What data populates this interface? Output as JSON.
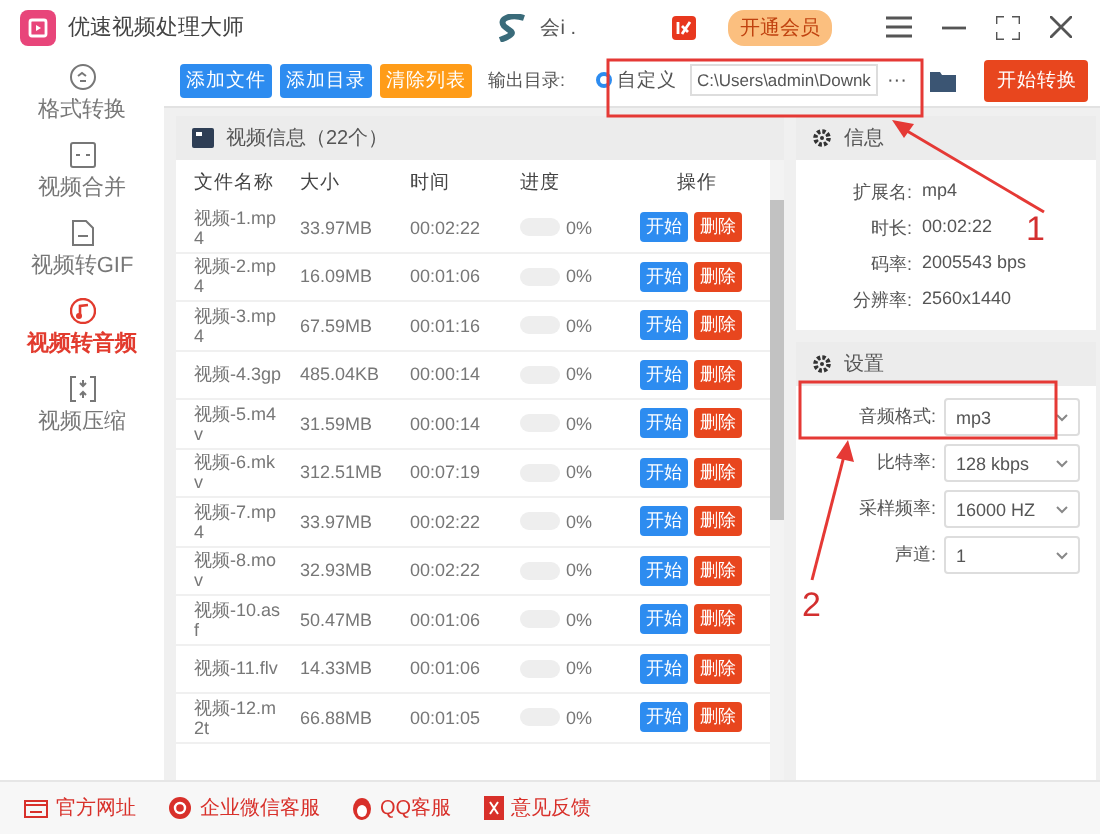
{
  "app": {
    "title": "优速视频处理大师"
  },
  "titlebar": {
    "user": "会i .",
    "vip_button": "开通会员"
  },
  "toolbar": {
    "buttons": [
      {
        "label": "添加文件",
        "kind": "primary"
      },
      {
        "label": "添加目录",
        "kind": "primary"
      },
      {
        "label": "清除列表",
        "kind": "warning"
      }
    ],
    "output_label": "输出目录:",
    "output_option": {
      "label": "自定义",
      "selected": true
    },
    "output_path": "C:\\Users\\admin\\Downk",
    "more": "···",
    "start_button": "开始转换"
  },
  "sidebar": {
    "items": [
      {
        "label": "格式转换",
        "selected": false,
        "kind": "convert"
      },
      {
        "label": "视频合并",
        "selected": false,
        "kind": "merge"
      },
      {
        "label": "视频转GIF",
        "selected": false,
        "kind": "gif"
      },
      {
        "label": "视频转音频",
        "selected": true,
        "kind": "audio"
      },
      {
        "label": "视频压缩",
        "selected": false,
        "kind": "compress"
      }
    ]
  },
  "file_panel": {
    "title": "视频信息（22个）",
    "columns": [
      "文件名称",
      "大小",
      "时间",
      "进度",
      "操作"
    ],
    "rows": [
      {
        "name": "视频-1.mp4",
        "size": "33.97MB",
        "time": "00:02:22",
        "level": 0,
        "progress": "0%",
        "actions": [
          "开始",
          "删除"
        ]
      },
      {
        "name": "视频-2.mp4",
        "size": "16.09MB",
        "time": "00:01:06",
        "level": 0,
        "progress": "0%",
        "actions": [
          "开始",
          "删除"
        ]
      },
      {
        "name": "视频-3.mp4",
        "size": "67.59MB",
        "time": "00:01:16",
        "level": 0,
        "progress": "0%",
        "actions": [
          "开始",
          "删除"
        ]
      },
      {
        "name": "视频-4.3gp",
        "size": "485.04KB",
        "time": "00:00:14",
        "level": 0,
        "progress": "0%",
        "actions": [
          "开始",
          "删除"
        ]
      },
      {
        "name": "视频-5.m4v",
        "size": "31.59MB",
        "time": "00:00:14",
        "level": 0,
        "progress": "0%",
        "actions": [
          "开始",
          "删除"
        ]
      },
      {
        "name": "视频-6.mkv",
        "size": "312.51MB",
        "time": "00:07:19",
        "level": 0,
        "progress": "0%",
        "actions": [
          "开始",
          "删除"
        ]
      },
      {
        "name": "视频-7.mp4",
        "size": "33.97MB",
        "time": "00:02:22",
        "level": 0,
        "progress": "0%",
        "actions": [
          "开始",
          "删除"
        ]
      },
      {
        "name": "视频-8.mov",
        "size": "32.93MB",
        "time": "00:02:22",
        "level": 0,
        "progress": "0%",
        "actions": [
          "开始",
          "删除"
        ]
      },
      {
        "name": "视频-10.asf",
        "size": "50.47MB",
        "time": "00:01:06",
        "level": 0,
        "progress": "0%",
        "actions": [
          "开始",
          "删除"
        ]
      },
      {
        "name": "视频-11.flv",
        "size": "14.33MB",
        "time": "00:01:06",
        "level": 0,
        "progress": "0%",
        "actions": [
          "开始",
          "删除"
        ]
      },
      {
        "name": "视频-12.m2t",
        "size": "66.88MB",
        "time": "00:01:05",
        "level": 0,
        "progress": "0%",
        "actions": [
          "开始",
          "删除"
        ]
      }
    ]
  },
  "info": {
    "title": "信息",
    "fields": [
      {
        "label": "扩展名:",
        "value": "mp4"
      },
      {
        "label": "时长:",
        "value": "00:02:22"
      },
      {
        "label": "码率:",
        "value": "2005543 bps"
      },
      {
        "label": "分辨率:",
        "value": "2560x1440"
      }
    ]
  },
  "settings": {
    "title": "设置",
    "fields": [
      {
        "label": "音频格式:",
        "value": "mp3"
      },
      {
        "label": "比特率:",
        "value": "128 kbps"
      },
      {
        "label": "采样频率:",
        "value": "16000 HZ"
      },
      {
        "label": "声道:",
        "value": "1"
      }
    ]
  },
  "footer": {
    "links": [
      {
        "label": "官方网址",
        "kind": "web"
      },
      {
        "label": "企业微信客服",
        "kind": "wechat"
      },
      {
        "label": "QQ客服",
        "kind": "qq"
      },
      {
        "label": "意见反馈",
        "kind": "feedback"
      }
    ]
  },
  "annotations": {
    "numbers": [
      "1",
      "2"
    ]
  }
}
